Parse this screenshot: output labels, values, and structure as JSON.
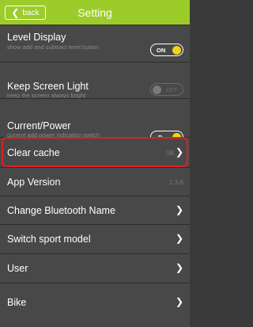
{
  "header": {
    "back_label": "back",
    "title": "Setting"
  },
  "settings": {
    "level_display": {
      "title": "Level Display",
      "subtitle": "show add and subtract level button",
      "toggle_label": "ON",
      "state": "on"
    },
    "keep_screen_light": {
      "title": "Keep Screen Light",
      "subtitle": "keep the screen always bright",
      "toggle_label": "OFF",
      "state": "off"
    },
    "current_power": {
      "title": "Current/Power",
      "subtitle": "current add power indication switch",
      "toggle_label": "P",
      "state": "on"
    },
    "clear_cache": {
      "title": "Clear cache",
      "value": "0B"
    },
    "app_version": {
      "title": "App Version",
      "value": "1.3.8"
    },
    "change_bluetooth_name": {
      "title": "Change Bluetooth Name"
    },
    "switch_sport_model": {
      "title": "Switch sport model"
    },
    "user": {
      "title": "User"
    },
    "bike": {
      "title": "Bike"
    }
  },
  "colors": {
    "header_bg": "#9ccc2a",
    "row_bg": "#484848",
    "toggle_on_knob": "#f2d21b",
    "highlight": "#e02020"
  }
}
